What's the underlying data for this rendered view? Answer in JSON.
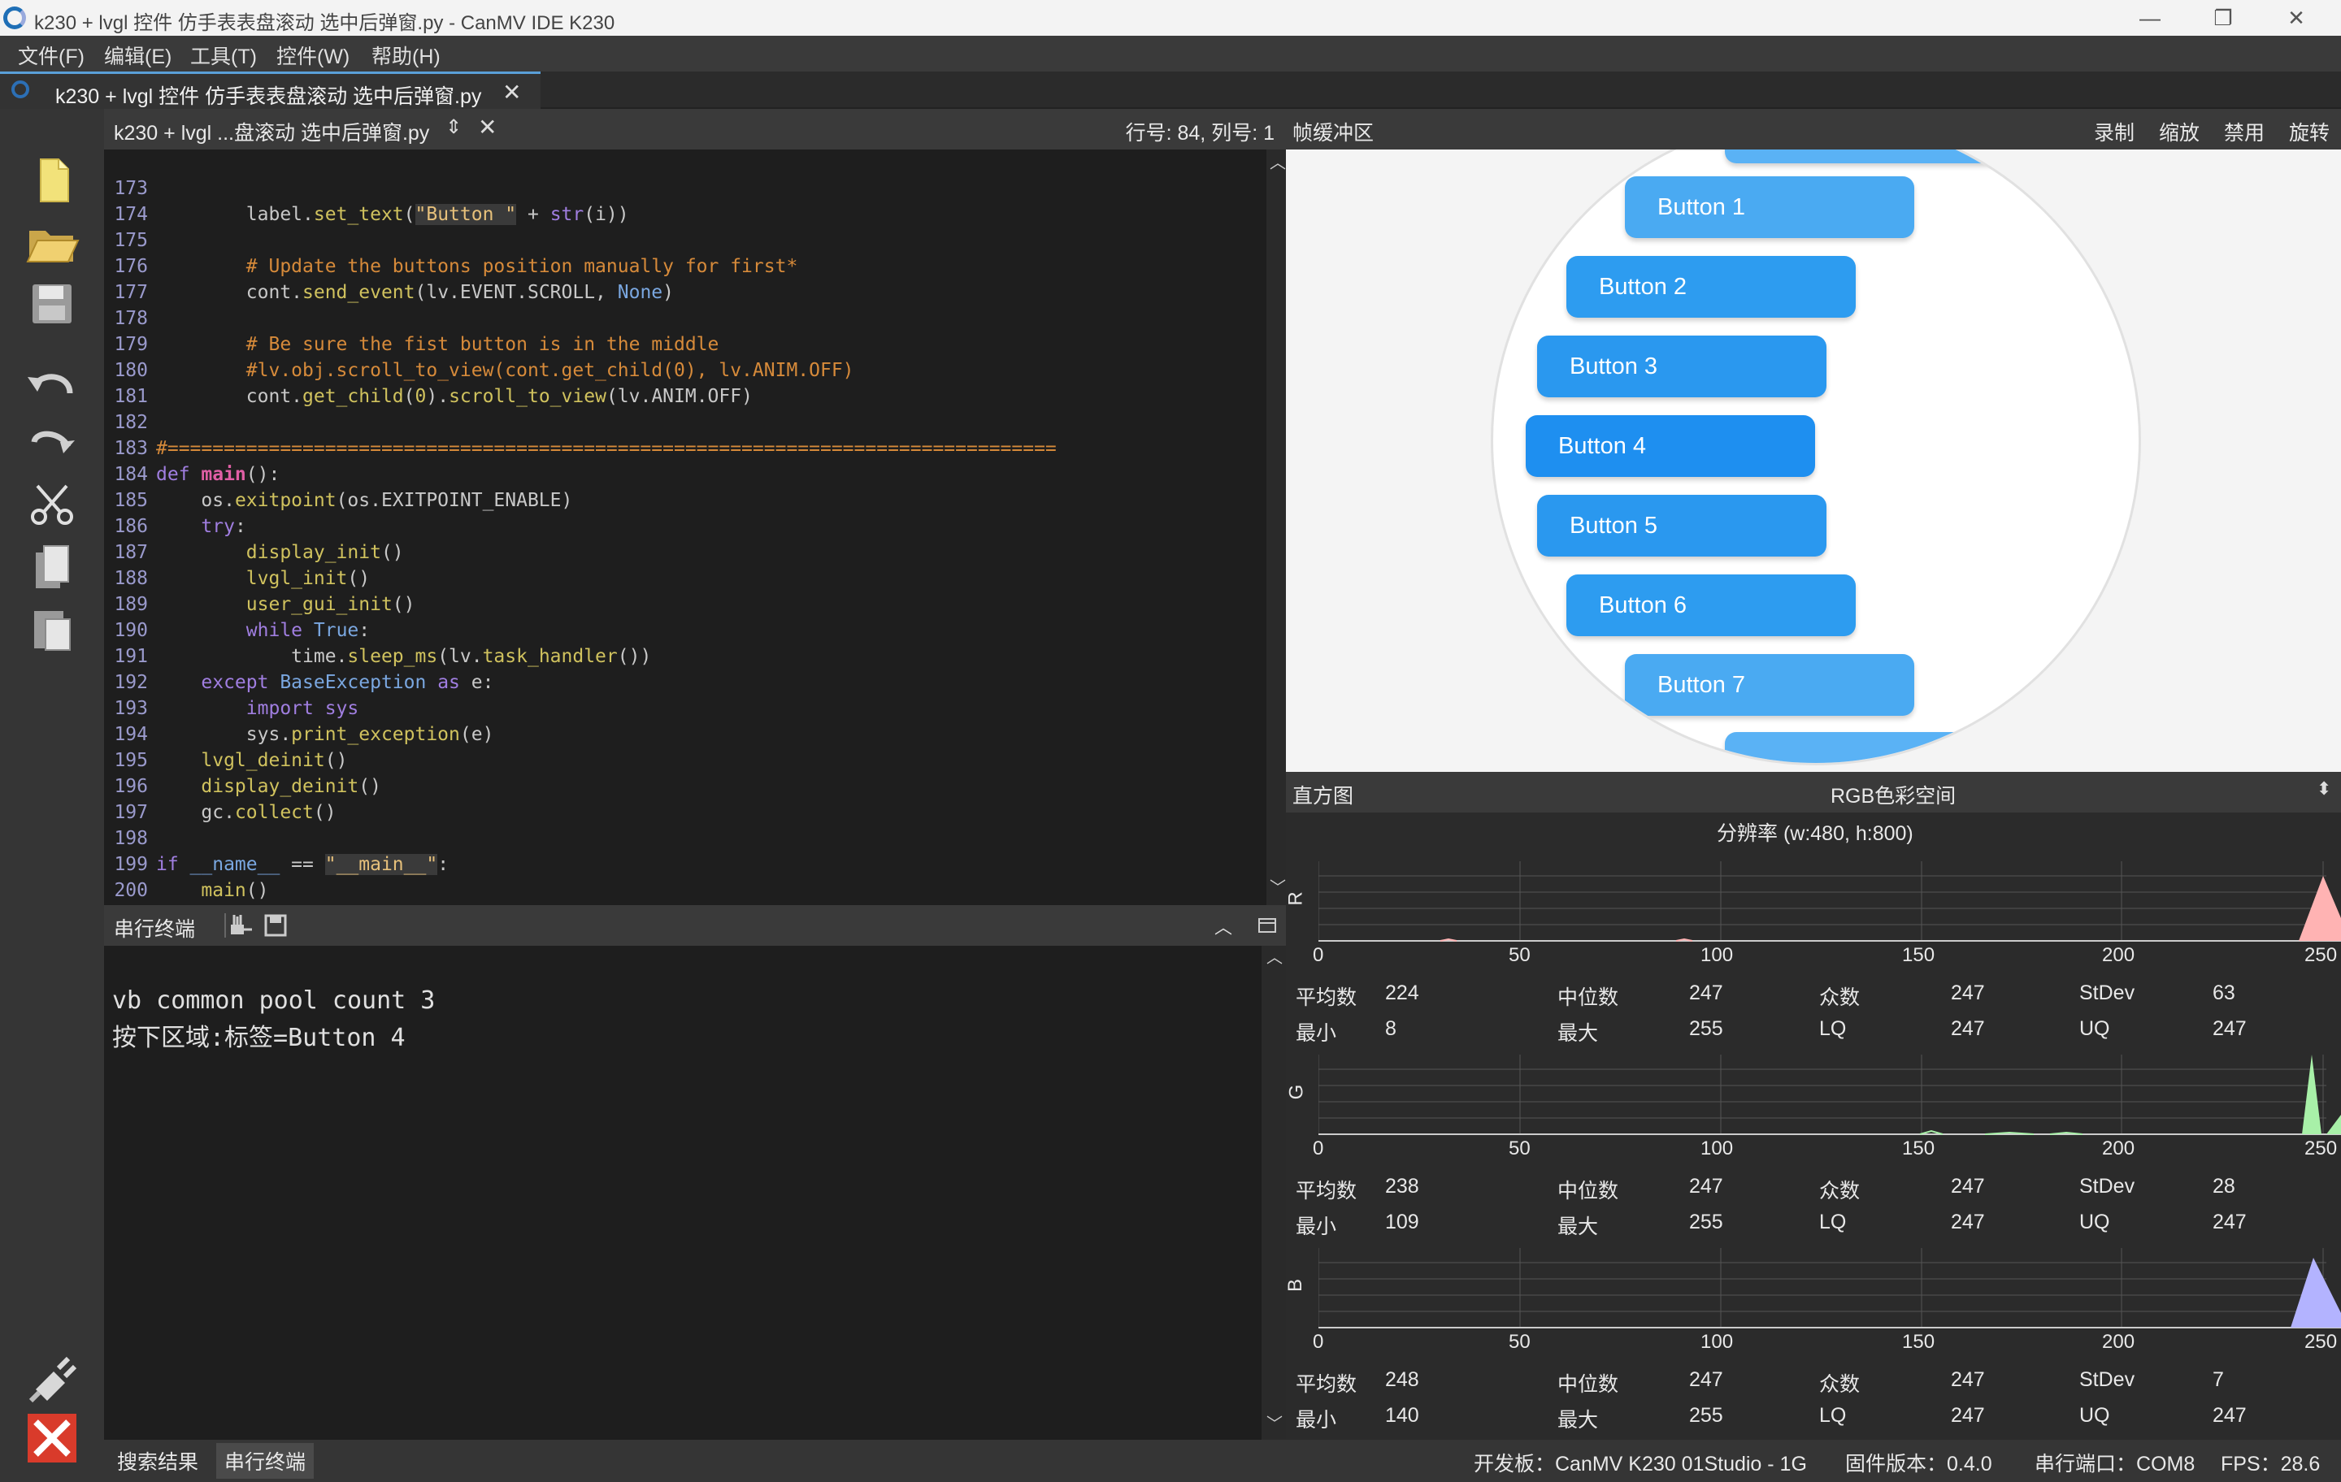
{
  "window": {
    "title": "k230 + lvgl 控件 仿手表表盘滚动 选中后弹窗.py - CanMV IDE K230",
    "minimize": "—",
    "maximize": "❐",
    "close": "✕"
  },
  "menu": [
    "文件(F)",
    "编辑(E)",
    "工具(T)",
    "控件(W)",
    "帮助(H)"
  ],
  "file_tab": {
    "label": "k230 + lvgl 控件 仿手表表盘滚动 选中后弹窗.py",
    "close": "✕"
  },
  "editor": {
    "file_name": "k230 + lvgl ...盘滚动 选中后弹窗.py",
    "updown": "⇕",
    "close": "✕",
    "cursor_pos": "行号: 84, 列号: 1",
    "scroll_up": "︿",
    "scroll_down": "﹀",
    "lines": [
      {
        "n": "173",
        "code": "        label.set_text(\"Button \" + str(i))"
      },
      {
        "n": "174",
        "code": ""
      },
      {
        "n": "175",
        "code": "        # Update the buttons position manually for first*"
      },
      {
        "n": "176",
        "code": "        cont.send_event(lv.EVENT.SCROLL, None)"
      },
      {
        "n": "177",
        "code": ""
      },
      {
        "n": "178",
        "code": "        # Be sure the fist button is in the middle"
      },
      {
        "n": "179",
        "code": "        #lv.obj.scroll_to_view(cont.get_child(0), lv.ANIM.OFF)"
      },
      {
        "n": "180",
        "code": "        cont.get_child(0).scroll_to_view(lv.ANIM.OFF)"
      },
      {
        "n": "181",
        "code": ""
      },
      {
        "n": "182",
        "code": "#==============================================================================="
      },
      {
        "n": "183",
        "code": "def main():"
      },
      {
        "n": "184",
        "code": "    os.exitpoint(os.EXITPOINT_ENABLE)"
      },
      {
        "n": "185",
        "code": "    try:"
      },
      {
        "n": "186",
        "code": "        display_init()"
      },
      {
        "n": "187",
        "code": "        lvgl_init()"
      },
      {
        "n": "188",
        "code": "        user_gui_init()"
      },
      {
        "n": "189",
        "code": "        while True:"
      },
      {
        "n": "190",
        "code": "            time.sleep_ms(lv.task_handler())"
      },
      {
        "n": "191",
        "code": "    except BaseException as e:"
      },
      {
        "n": "192",
        "code": "        import sys"
      },
      {
        "n": "193",
        "code": "        sys.print_exception(e)"
      },
      {
        "n": "194",
        "code": "    lvgl_deinit()"
      },
      {
        "n": "195",
        "code": "    display_deinit()"
      },
      {
        "n": "196",
        "code": "    gc.collect()"
      },
      {
        "n": "197",
        "code": ""
      },
      {
        "n": "198",
        "code": "if __name__ == \"__main__\":"
      },
      {
        "n": "199",
        "code": "    main()"
      },
      {
        "n": "200",
        "code": ""
      }
    ]
  },
  "framebuffer": {
    "title": "帧缓冲区",
    "record": "录制",
    "zoom": "缩放",
    "disable": "禁用",
    "rotate": "旋转",
    "buttons": [
      "Button 1",
      "Button 2",
      "Button 3",
      "Button 4",
      "Button 5",
      "Button 6",
      "Button 7"
    ],
    "button_color": "#2d9cf0",
    "button_color_selected": "#1e8ff0"
  },
  "histogram": {
    "title": "直方图",
    "colorspace": "RGB色彩空间",
    "arrow": "⬍",
    "resolution": "分辨率 (w:480, h:800)",
    "ticks": [
      "0",
      "50",
      "100",
      "150",
      "200",
      "250"
    ],
    "stat_labels": {
      "mean": "平均数",
      "median": "中位数",
      "mode": "众数",
      "stdev": "StDev",
      "min": "最小",
      "max": "最大",
      "lq": "LQ",
      "uq": "UQ"
    },
    "channels": [
      {
        "axis": "R",
        "color": "#ffb3b3",
        "mean": "224",
        "median": "247",
        "mode": "247",
        "stdev": "63",
        "min": "8",
        "max": "255",
        "lq": "247",
        "uq": "247"
      },
      {
        "axis": "G",
        "color": "#a8f0a8",
        "mean": "238",
        "median": "247",
        "mode": "247",
        "stdev": "28",
        "min": "109",
        "max": "255",
        "lq": "247",
        "uq": "247"
      },
      {
        "axis": "B",
        "color": "#b3b3ff",
        "mean": "248",
        "median": "247",
        "mode": "247",
        "stdev": "7",
        "min": "140",
        "max": "255",
        "lq": "247",
        "uq": "247"
      }
    ]
  },
  "terminal": {
    "title": "串行终端",
    "up": "︿",
    "lines": [
      "vb common pool count 3",
      "按下区域:标签=Button 4"
    ]
  },
  "statusbar": {
    "tab_search": "搜索结果",
    "tab_serial": "串行终端",
    "board": "开发板：CanMV K230 01Studio - 1G",
    "firmware": "固件版本：0.4.0",
    "port": "串行端口：COM8",
    "fps": "FPS：28.6"
  }
}
